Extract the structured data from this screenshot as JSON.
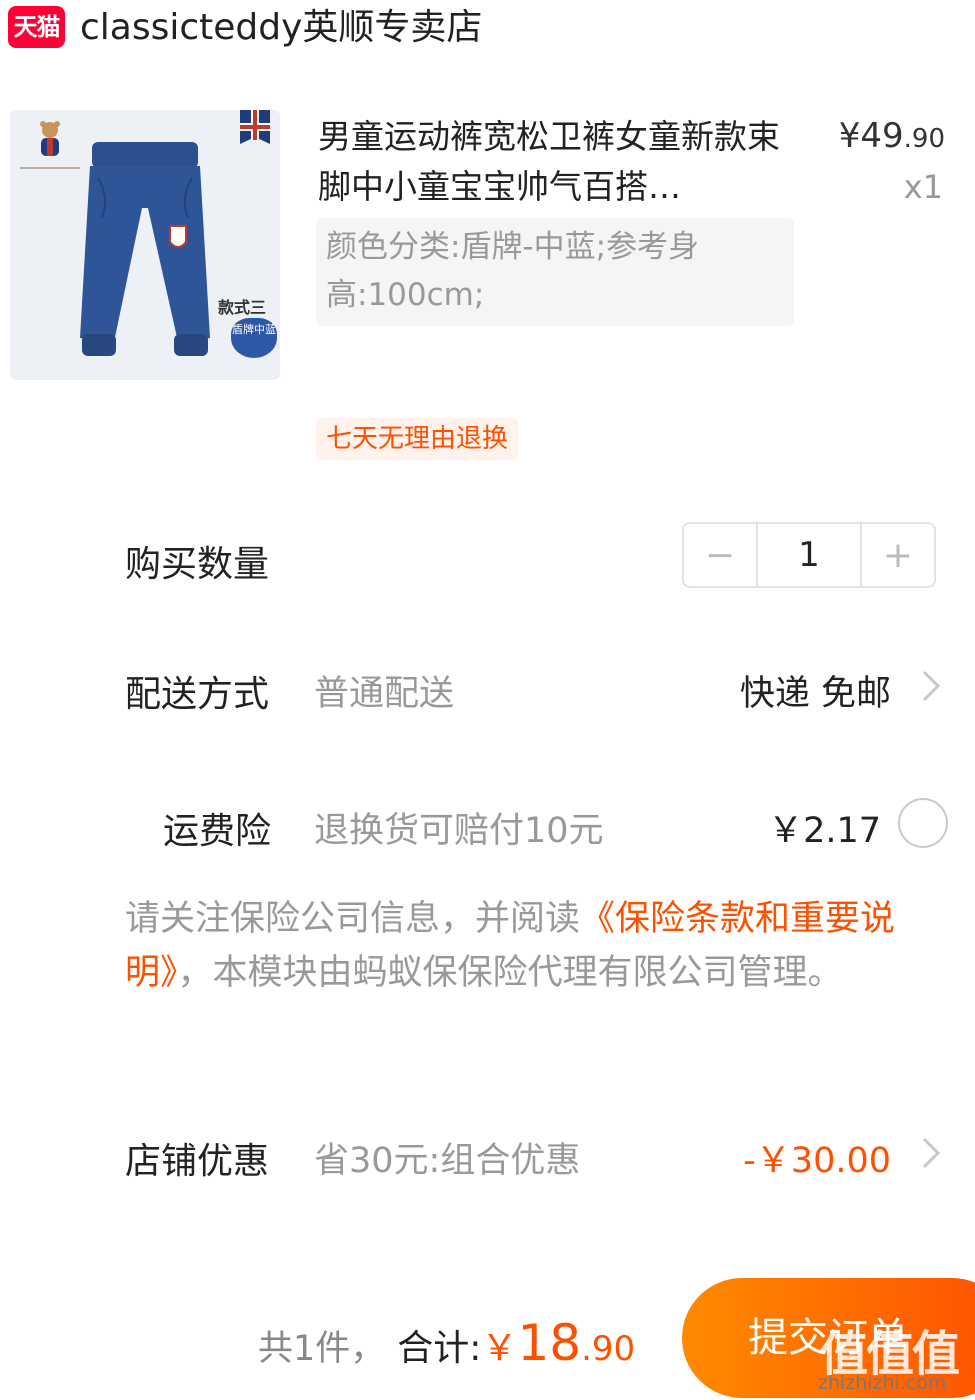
{
  "store": {
    "badge": "天猫",
    "name": "classicteddy英顺专卖店"
  },
  "product": {
    "image_style_label": "款式三",
    "image_style_tag": "盾牌中蓝",
    "title": "男童运动裤宽松卫裤女童新款束脚中小童宝宝帅气百搭…",
    "price_int": "¥49",
    "price_dec": ".90",
    "quantity": "x1",
    "sku": "颜色分类:盾牌-中蓝;参考身高:100cm;",
    "return_tag": "七天无理由退换"
  },
  "purchase_qty": {
    "label": "购买数量",
    "minus": "−",
    "value": "1",
    "plus": "+"
  },
  "delivery": {
    "label": "配送方式",
    "sub": "普通配送",
    "value": "快递 免邮"
  },
  "shipping_insurance": {
    "label": "运费险",
    "sub": "退换货可赔付10元",
    "price": "￥2.17"
  },
  "notice": {
    "before": "请关注保险公司信息，并阅读",
    "link": "《保险条款和重要说明》",
    "after": "，本模块由蚂蚁保保险代理有限公司管理。"
  },
  "store_discount": {
    "label": "店铺优惠",
    "sub": "省30元:组合优惠",
    "value": "-￥30.00"
  },
  "footer": {
    "count": "共1件，",
    "total_label": "合计:",
    "total_currency": "￥",
    "total_int": "18",
    "total_dec": ".90",
    "submit": "提交订单"
  },
  "watermark": {
    "text": "值值值",
    "url": "zhizhizhi.com"
  },
  "colors": {
    "accent": "#ff5000",
    "tmall_red": "#ff0036",
    "muted": "#999999"
  }
}
